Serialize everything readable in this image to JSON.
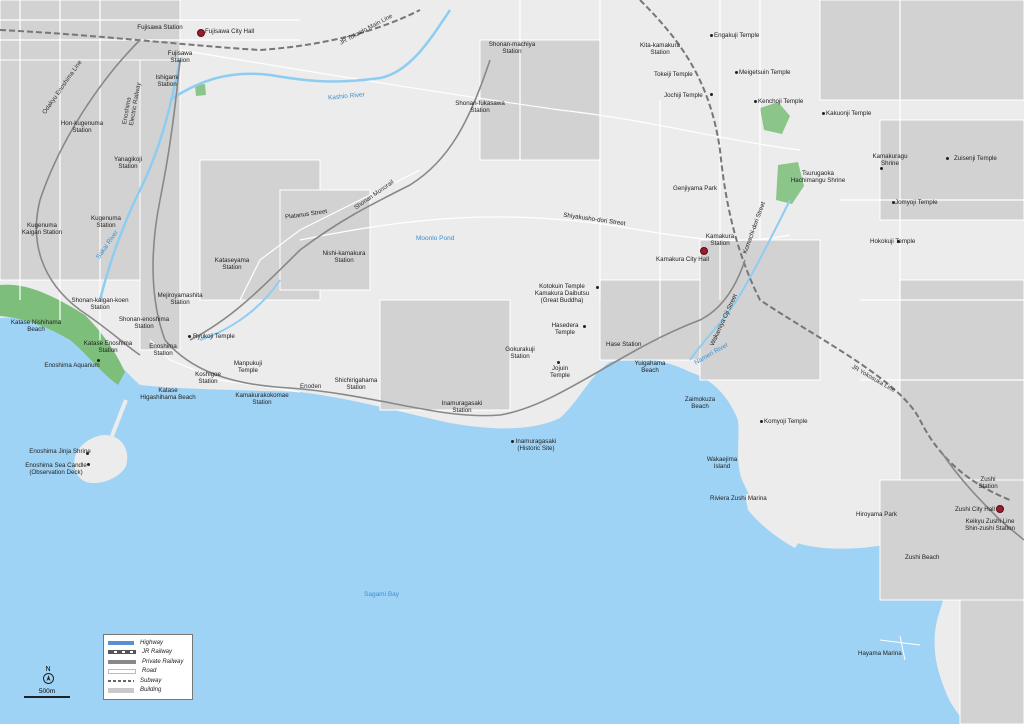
{
  "colors": {
    "land": "#ececec",
    "sea": "#9fd3f5",
    "road": "#ffffff",
    "building": "#c9c9c9",
    "park": "#8cc58a",
    "beach_green": "#7dbf7a",
    "river": "#8ecdf2",
    "city_hall": "#9b1c2c",
    "rail": "#777777"
  },
  "labels": {
    "fujisawa_station": "Fujisawa Station",
    "fujisawa_city_hall": "Fujisawa City Hall",
    "jr_tokaido": "JR Tokaido Main Line",
    "odakyu": "Odakyu Enoshima Line",
    "fujisawa_station2": "Fujisawa\nStation",
    "ishigami": "Ishigami\nStation",
    "enoden_line": "Enoshima\nElectric Railway",
    "hon_kugenuma": "Hon-kugenuma\nStation",
    "yanagikoji": "Yanagikoji\nStation",
    "kugenuma": "Kugenuma\nStation",
    "kugenuma_kaigan": "Kugenuma\nKaigan Station",
    "sakai_river": "Sakai River",
    "kashio_river": "Kashio River",
    "shonan_machiya": "Shonan-machiya\nStation",
    "shonan_fukasawa": "Shonan-fukasawa\nStation",
    "shonan_monorail": "Shonan Monorail",
    "platanus": "Platanus Street",
    "kataseyama": "Kataseyama\nStation",
    "nishi_kamakura": "Nishi-kamakura\nStation",
    "mejiroyamashita": "Mejiroyamashita\nStation",
    "shonan_kaigan_koen": "Shonan-kaigan-koen\nStation",
    "shonan_enoshima": "Shonan-enoshima\nStation",
    "enoshima_station": "Enoshima\nStation",
    "katase_enoshima": "Katase Enoshima\nStation",
    "katase_nishihama": "Katase Nishihama\nBeach",
    "enoshima_aquarium": "Enoshima Aquarium",
    "ryukoji": "Ryukoji Temple",
    "koshigoe": "Koshigoe\nStation",
    "manpukuji": "Manpukuji\nTemple",
    "katase_higashihama": "Katase\nHigashihama Beach",
    "kamakurakokomae": "Kamakurakokomae\nStation",
    "enoden": "Enoden",
    "shichirigahama": "Shichirigahama\nStation",
    "enoshima_jinja": "Enoshima Jinja Shrine",
    "sea_candle": "Enoshima Sea Candle\n(Observation Deck)",
    "moon_pond": "Moonlo Pond",
    "shiyakusho_dori": "Shiyakusho-dori Street",
    "kotokuin": "Kotokuin Temple\nKamakura Daibutsu\n(Great Buddha)",
    "hasedera": "Hasedera\nTemple",
    "hase_station": "Hase Station",
    "gokurakuji": "Gokurakuji\nStation",
    "jojuin": "Jojuin\nTemple",
    "inamuragasaki_station": "Inamuragasaki\nStation",
    "inamuragasaki_site": "Inamuragasaki\n(Historic Site)",
    "yuigahama": "Yuigahama\nBeach",
    "kita_kamakura": "Kita-kamakura\nStation",
    "engakuji": "Engakuji Temple",
    "tokeiji": "Tokeiji Temple",
    "meigetsuin": "Meigetsuin Temple",
    "jochiji": "Jochiji Temple",
    "kenchoji": "Kenchoji Temple",
    "kakuonji": "Kakuonji Temple",
    "genjiyama": "Genjiyama Park",
    "tsurugaoka": "Tsurugaoka\nHachimangu Shrine",
    "kamakuragu": "Kamakuragu\nShrine",
    "zuisenji": "Zuisenji Temple",
    "jomyoji": "Jomyoji Temple",
    "hokokuji": "Hokokuji Temple",
    "kamakura_station": "Kamakura\nStation",
    "kamakura_city_hall": "Kamakura City Hall",
    "komachi_dori": "Komachi-dori Street",
    "wakamiya_oji": "Wakamiya Oji Street",
    "nameri_river": "Nameri River",
    "jr_yokosuka": "JR Yokosuka Line",
    "zaimokuza": "Zaimokuza\nBeach",
    "komyoji": "Komyoji Temple",
    "wakaejima": "Wakaejima\nIsland",
    "riviera_zushi": "Riviera Zushi Marina",
    "zushi_station": "Zushi\nStation",
    "zushi_city_hall": "Zushi City Hall",
    "shin_zushi": "Keikyu Zushi Line\nShin-zushi Station",
    "hiroyama": "Hiroyama Park",
    "zushi_beach": "Zushi Beach",
    "sagami_bay": "Sagami Bay",
    "hayama_marina": "Hayama Marina"
  },
  "legend": [
    {
      "label": "Highway",
      "style": "highway"
    },
    {
      "label": "JR Railway",
      "style": "jr"
    },
    {
      "label": "Private Railway",
      "style": "private"
    },
    {
      "label": "Road",
      "style": "road"
    },
    {
      "label": "Subway",
      "style": "subway"
    },
    {
      "label": "Building",
      "style": "building"
    }
  ],
  "north": "N",
  "scale": "500m"
}
